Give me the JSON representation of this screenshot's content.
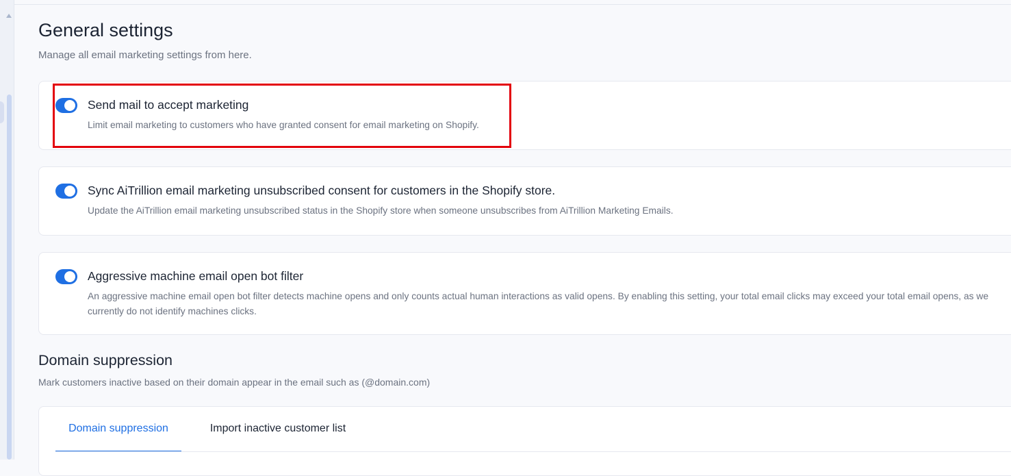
{
  "header": {
    "title": "General settings",
    "subtitle": "Manage all email marketing settings from here."
  },
  "settings": [
    {
      "title": "Send mail to accept marketing",
      "description": "Limit email marketing to customers who have granted consent for email marketing on Shopify.",
      "enabled": true
    },
    {
      "title": "Sync AiTrillion email marketing unsubscribed consent for customers in the Shopify store.",
      "description": "Update the AiTrillion email marketing unsubscribed status in the Shopify store when someone unsubscribes from AiTrillion Marketing Emails.",
      "enabled": true
    },
    {
      "title": "Aggressive machine email open bot filter",
      "description": "An aggressive machine email open bot filter detects machine opens and only counts actual human interactions as valid opens. By enabling this setting, your total email clicks may exceed your total email opens, as we currently do not identify machines clicks.",
      "enabled": true
    }
  ],
  "domain_suppression": {
    "title": "Domain suppression",
    "subtitle": "Mark customers inactive based on their domain appear in the email such as (@domain.com)",
    "tabs": [
      {
        "label": "Domain suppression",
        "active": true
      },
      {
        "label": "Import inactive customer list",
        "active": false
      }
    ]
  },
  "colors": {
    "accent": "#1f6fe3",
    "highlight": "#e3000b",
    "background": "#f8f9fc"
  }
}
